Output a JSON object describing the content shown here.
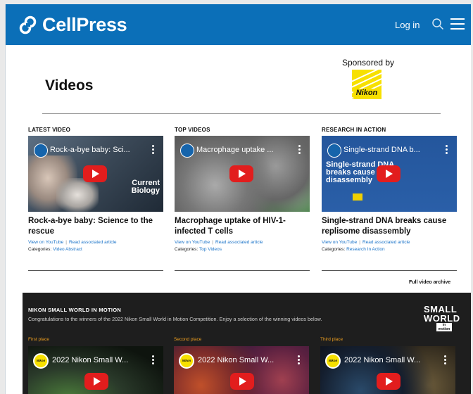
{
  "header": {
    "brand": "CellPress",
    "login_label": "Log in"
  },
  "page": {
    "title": "Videos",
    "sponsor_label": "Sponsored by",
    "sponsor_name": "Nikon"
  },
  "videos": [
    {
      "section_label": "LATEST VIDEO",
      "thumb_title": "Rock-a-bye baby: Sci...",
      "thumb_overlay": [
        "Current",
        "Biology"
      ],
      "title": "Rock-a-bye baby: Science to the rescue",
      "link_youtube": "View on YouTube",
      "link_article": "Read associated article",
      "categories_label": "Categories:",
      "category": "Video Abstract"
    },
    {
      "section_label": "TOP VIDEOS",
      "thumb_title": "Macrophage uptake ...",
      "title": "Macrophage uptake of HIV-1-infected T cells",
      "link_youtube": "View on YouTube",
      "link_article": "Read associated article",
      "categories_label": "Categories:",
      "category": "Top Videos"
    },
    {
      "section_label": "RESEARCH IN ACTION",
      "thumb_title": "Single-strand DNA b...",
      "thumb_overlay": [
        "Single-strand DNA",
        "breaks cause",
        "disassembly"
      ],
      "title": "Single-strand DNA breaks cause replisome disassembly",
      "link_youtube": "View on YouTube",
      "link_article": "Read associated article",
      "categories_label": "Categories:",
      "category": "Research In Action"
    }
  ],
  "archive_link": "Full video archive",
  "small_world": {
    "label": "NIKON SMALL WORLD IN MOTION",
    "description": "Congratulations to the winners of the 2022 Nikon Small World in Motion Competition. Enjoy a selection of the winning videos below.",
    "logo_line1": "SMALL",
    "logo_line2": "WORLD",
    "logo_line3": "in motion",
    "avatar_text": "Nikon",
    "entries": [
      {
        "place": "First place",
        "thumb_title": "2022 Nikon Small W..."
      },
      {
        "place": "Second place",
        "thumb_title": "2022 Nikon Small W..."
      },
      {
        "place": "Third place",
        "thumb_title": "2022 Nikon Small W..."
      }
    ]
  },
  "colors": {
    "brand_blue": "#0b6fb8",
    "link_blue": "#1a73c8",
    "play_red": "#e21d1d",
    "place_orange": "#f0a020",
    "nikon_yellow": "#f7e000"
  }
}
